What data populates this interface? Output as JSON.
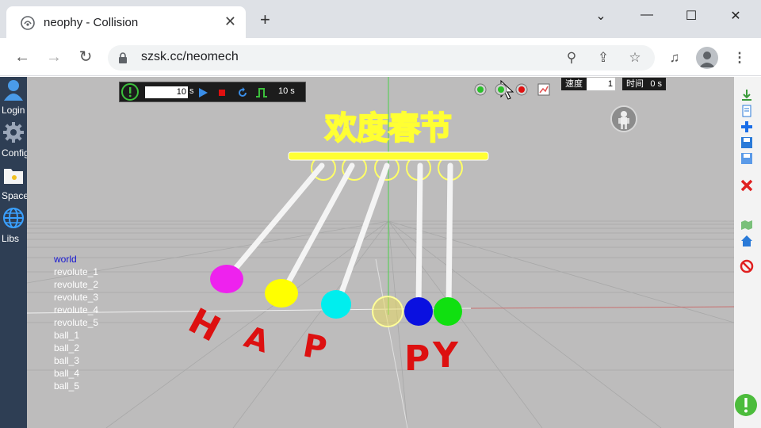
{
  "browser": {
    "tab_title": "neophy - Collision",
    "url": "szsk.cc/neomech",
    "new_tab_symbol": "+",
    "close_symbol": "✕"
  },
  "left_sidebar": {
    "items": [
      {
        "label": "Login",
        "icon": "user-icon"
      },
      {
        "label": "Config",
        "icon": "gear-icon"
      },
      {
        "label": "Space",
        "icon": "folder-icon"
      },
      {
        "label": "Libs",
        "icon": "globe-icon"
      }
    ]
  },
  "sim_toolbar": {
    "duration_value": "10",
    "duration_unit": "s",
    "time_text": "10 s"
  },
  "controls": {
    "speed_label": "速度",
    "speed_value": "1",
    "time_label": "时间",
    "time_value": "0 s"
  },
  "scene": {
    "banner_text": "欢度春节",
    "letters": [
      "H",
      "A",
      "P",
      "P",
      "Y"
    ],
    "ball_colors": [
      "#ee22ee",
      "#ffff00",
      "#00eeee",
      "#f0e050",
      "#0a10e0",
      "#10e010"
    ],
    "accent_color": "#ffff33",
    "banner_color": "#d40000"
  },
  "tree": {
    "root": "world",
    "items": [
      "revolute_1",
      "revolute_2",
      "revolute_3",
      "revolute_4",
      "revolute_5",
      "ball_1",
      "ball_2",
      "ball_3",
      "ball_4",
      "ball_5"
    ]
  }
}
